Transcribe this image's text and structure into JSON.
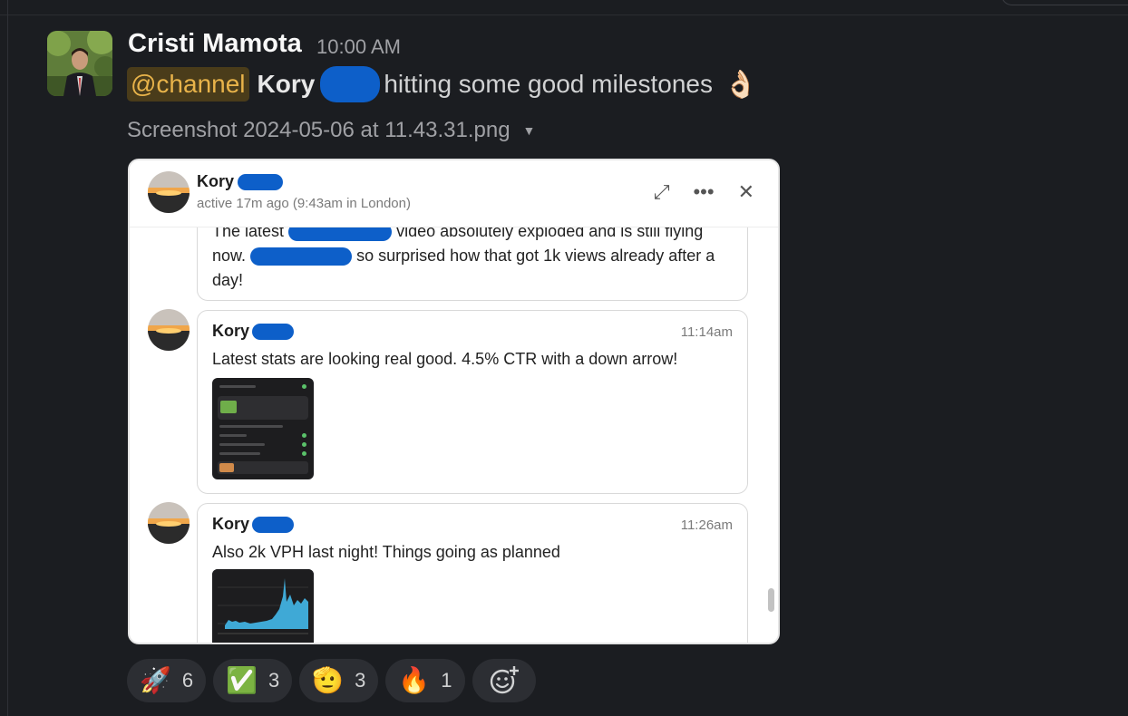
{
  "message": {
    "sender": "Cristi Mamota",
    "time": "10:00 AM",
    "mention": "@channel",
    "mention_target": "Kory",
    "text": "hitting some good milestones",
    "emoji": "👌🏻",
    "attachment_name": "Screenshot 2024-05-06 at 11.43.31.png"
  },
  "screenshot": {
    "header": {
      "name": "Kory",
      "status": "active 17m ago (9:43am in London)",
      "icons": [
        "expand-icon",
        "more-icon",
        "close-icon"
      ]
    },
    "messages": [
      {
        "line1_a": "The latest",
        "line1_b": "video absolutely exploded and is still flying",
        "line2_a": "now.",
        "line2_b": "so surprised how that got 1k views already after a",
        "line3": "day!"
      },
      {
        "name": "Kory",
        "time": "11:14am",
        "text": "Latest stats are looking real good. 4.5% CTR with a down arrow!"
      },
      {
        "name": "Kory",
        "time": "11:26am",
        "text": "Also 2k VPH last night! Things going as planned"
      }
    ]
  },
  "reactions": [
    {
      "emoji": "🚀",
      "count": "6"
    },
    {
      "emoji": "✅",
      "count": "3"
    },
    {
      "emoji": "🫡",
      "count": "3"
    },
    {
      "emoji": "🔥",
      "count": "1"
    }
  ],
  "add_reaction_icon": "add-reaction-icon"
}
